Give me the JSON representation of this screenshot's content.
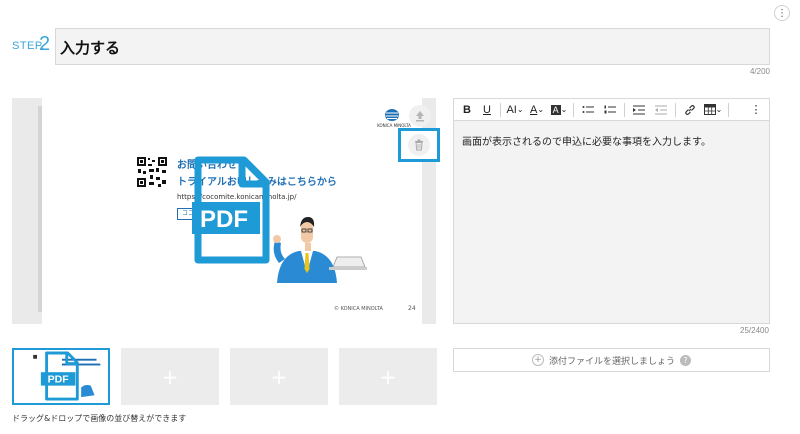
{
  "step": {
    "label": "STEP.",
    "number": "2"
  },
  "title": {
    "value": "入力する",
    "count": "4/200"
  },
  "slide": {
    "logo_text": "KONICA MINOLTA",
    "line1": "お問い合わせ",
    "line2": "トライアルお申し込みはこちらから",
    "url": "https://cocomite.konicaminolta.jp/",
    "box_text": "ココミテ",
    "footer": "© KONICA MINOLTA",
    "page": "24",
    "pdf_label": "PDF"
  },
  "toolbar": {
    "bold": "B",
    "underline": "U",
    "font_size": "AI",
    "font_color": "A",
    "highlight": "A",
    "chevron": "⌄"
  },
  "editor": {
    "text": "画面が表示されるので申込に必要な事項を入力します。",
    "count": "25/2400"
  },
  "attach": {
    "label": "添付ファイルを選択しましょう",
    "help": "?"
  },
  "thumbs": {
    "plus": "+",
    "pdf_label": "PDF"
  },
  "drag_hint": "ドラッグ&ドロップで画像の並び替えができます",
  "colors": {
    "accent": "#1e9ad6",
    "step": "#3aa6dc",
    "slide_blue": "#1f6fb5"
  }
}
